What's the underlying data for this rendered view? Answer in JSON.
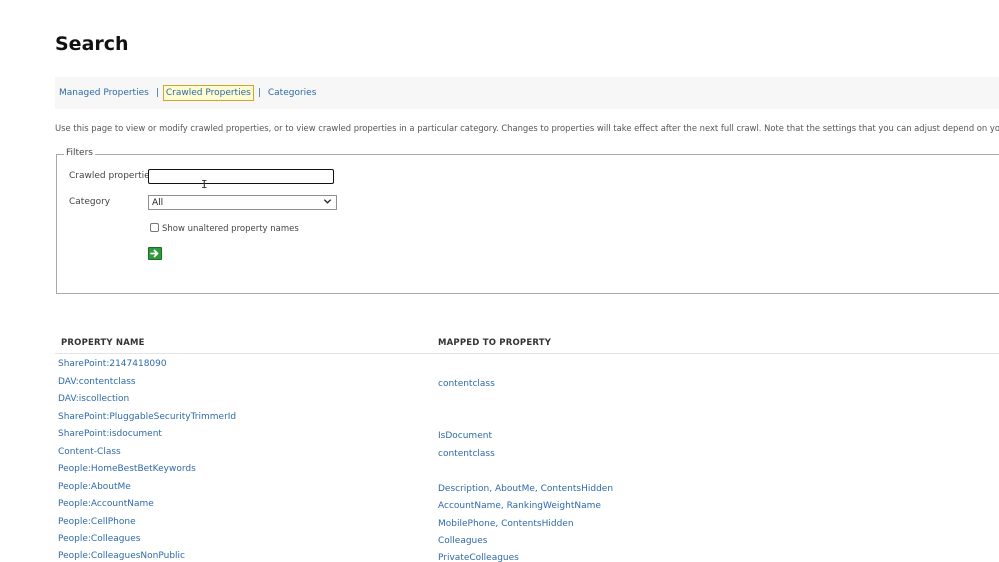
{
  "page": {
    "title": "Search",
    "description": "Use this page to view or modify crawled properties, or to view crawled properties in a particular category. Changes to properties will take effect after the next full crawl. Note that the settings that you can adjust depend on your current a"
  },
  "tabs": [
    {
      "label": "Managed Properties"
    },
    {
      "label": "Crawled Properties"
    },
    {
      "label": "Categories"
    }
  ],
  "tab_separator": "|",
  "filters": {
    "legend": "Filters",
    "crawled_properties_label": "Crawled properties",
    "crawled_properties_value": "",
    "category_label": "Category",
    "category_selected": "All",
    "show_unaltered_label": "Show unaltered property names",
    "show_unaltered_checked": false
  },
  "table": {
    "headers": {
      "property_name": "PROPERTY NAME",
      "mapped_to": "MAPPED TO PROPERTY"
    },
    "rows": [
      {
        "name": "SharePoint:2147418090",
        "mapped": ""
      },
      {
        "name": "DAV:contentclass",
        "mapped": "contentclass"
      },
      {
        "name": "DAV:iscollection",
        "mapped": ""
      },
      {
        "name": "SharePoint:PluggableSecurityTrimmerId",
        "mapped": ""
      },
      {
        "name": "SharePoint:isdocument",
        "mapped": "IsDocument"
      },
      {
        "name": "Content-Class",
        "mapped": "contentclass"
      },
      {
        "name": "People:HomeBestBetKeywords",
        "mapped": ""
      },
      {
        "name": "People:AboutMe",
        "mapped": "Description, AboutMe, ContentsHidden"
      },
      {
        "name": "People:AccountName",
        "mapped": "AccountName, RankingWeightName"
      },
      {
        "name": "People:CellPhone",
        "mapped": "MobilePhone, ContentsHidden"
      },
      {
        "name": "People:Colleagues",
        "mapped": "Colleagues"
      },
      {
        "name": "People:ColleaguesNonPublic",
        "mapped": "PrivateColleagues"
      }
    ]
  },
  "icons": {
    "go_button": "arrow-right-icon",
    "text_cursor": "ibeam-cursor-icon",
    "select_chevron": "chevron-down-icon"
  },
  "colors": {
    "link": "#2e6aa6",
    "active_tab_bg": "#fffbd1",
    "active_tab_border": "#c9a82f",
    "go_button": "#2f9a3a"
  }
}
